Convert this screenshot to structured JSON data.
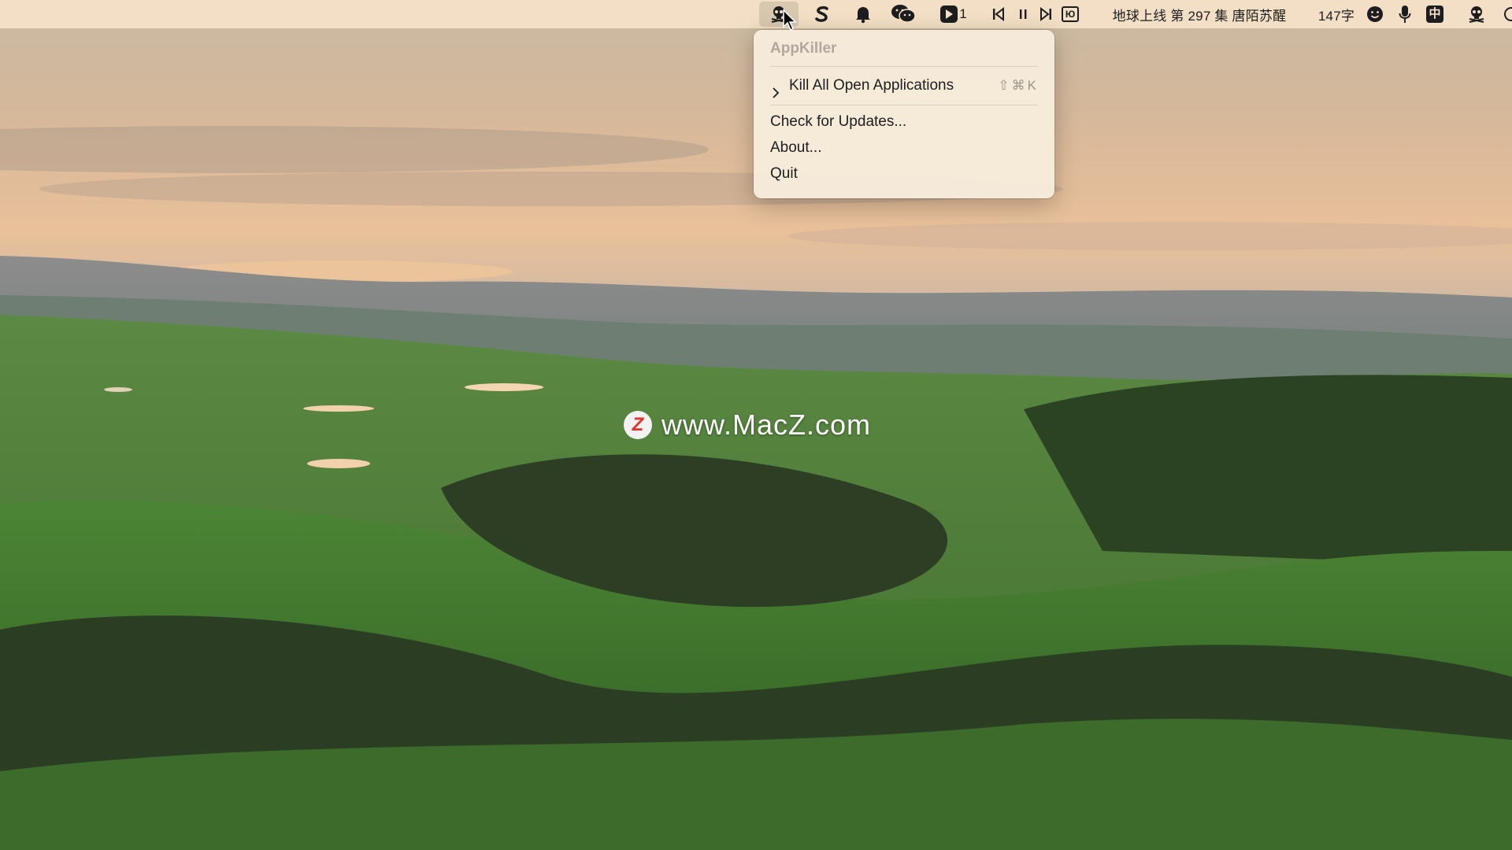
{
  "menubar": {
    "icons": [
      "appkiller-skull-icon",
      "s-app-icon",
      "bell-icon",
      "wechat-icon",
      "player-app-icon",
      "previous-track-icon",
      "pause-icon",
      "next-track-icon",
      "lyrics-icon",
      "emoji-icon",
      "microphone-icon",
      "input-method-icon",
      "skull-icon",
      "control-center-icon"
    ],
    "player_badge": "1",
    "now_playing": "地球上线 第 297 集 唐陌苏醒",
    "word_count": "147字",
    "input_method": "中",
    "lyrics_glyph": "Ю"
  },
  "menu": {
    "title": "AppKiller",
    "items": [
      {
        "label": "Kill All Open Applications",
        "shortcut": "⇧⌘K",
        "has_submenu": true
      },
      {
        "label": "Check for Updates..."
      },
      {
        "label": "About..."
      },
      {
        "label": "Quit"
      }
    ]
  },
  "watermark": {
    "logo_letter": "Z",
    "text": "www.MacZ.com"
  }
}
